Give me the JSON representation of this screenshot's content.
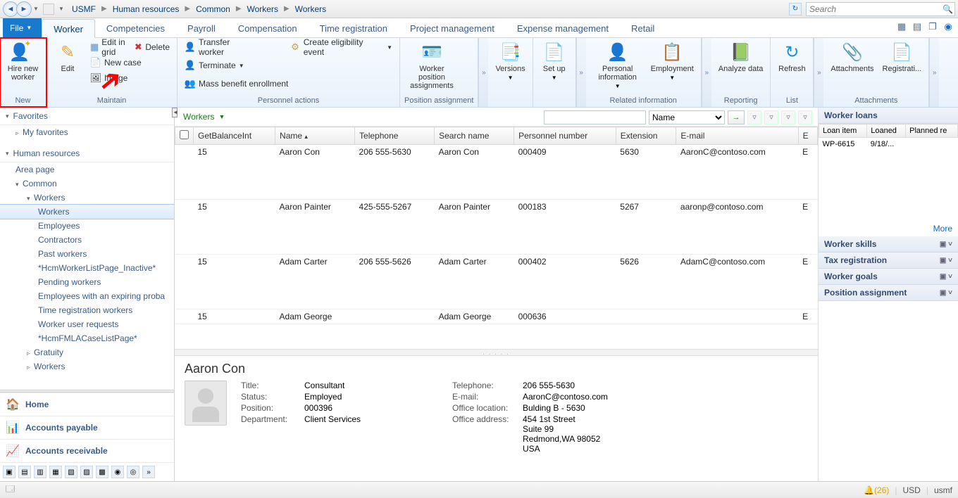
{
  "topbar": {
    "breadcrumb": [
      "USMF",
      "Human resources",
      "Common",
      "Workers",
      "Workers"
    ],
    "search_placeholder": "Search"
  },
  "ribbon": {
    "file": "File",
    "tabs": [
      "Worker",
      "Competencies",
      "Payroll",
      "Compensation",
      "Time registration",
      "Project management",
      "Expense management",
      "Retail"
    ],
    "groups": {
      "new": {
        "label": "New",
        "hire": "Hire new worker"
      },
      "maintain": {
        "label": "Maintain",
        "edit": "Edit",
        "edit_grid": "Edit in grid",
        "delete": "Delete",
        "new_case": "New case",
        "image": "Image"
      },
      "personnel": {
        "label": "Personnel actions",
        "transfer": "Transfer worker",
        "terminate": "Terminate",
        "mass": "Mass benefit enrollment",
        "eligibility": "Create eligibility event"
      },
      "position": {
        "label": "Position assignment",
        "btn": "Worker position assignments"
      },
      "versions": {
        "label": "",
        "btn": "Versions"
      },
      "setup": {
        "label": "",
        "btn": "Set up"
      },
      "related": {
        "label": "Related information",
        "personal": "Personal information",
        "employment": "Employment"
      },
      "reporting": {
        "label": "Reporting",
        "btn": "Analyze data"
      },
      "list": {
        "label": "List",
        "btn": "Refresh"
      },
      "attachments": {
        "label": "Attachments",
        "a": "Attachments",
        "b": "Registrati..."
      }
    }
  },
  "leftnav": {
    "favorites": "Favorites",
    "my_favorites": "My favorites",
    "hr": "Human resources",
    "area": "Area page",
    "common": "Common",
    "workers": "Workers",
    "items": [
      "Workers",
      "Employees",
      "Contractors",
      "Past workers",
      "*HcmWorkerListPage_Inactive*",
      "Pending workers",
      "Employees with an expiring proba",
      "Time registration workers",
      "Worker user requests",
      "*HcmFMLACaseListPage*"
    ],
    "gratuity": "Gratuity",
    "workers2": "Workers",
    "home": "Home",
    "ap": "Accounts payable",
    "ar": "Accounts receivable"
  },
  "list": {
    "title": "Workers",
    "filter_field": "Name",
    "cols": [
      "",
      "GetBalanceInt",
      "Name",
      "Telephone",
      "Search name",
      "Personnel number",
      "Extension",
      "E-mail",
      "E"
    ],
    "rows": [
      {
        "bal": "15",
        "name": "Aaron Con",
        "tel": "206 555-5630",
        "search": "Aaron Con",
        "pnum": "000409",
        "ext": "5630",
        "email": "AaronC@contoso.com",
        "e": "E"
      },
      {
        "bal": "15",
        "name": "Aaron Painter",
        "tel": "425-555-5267",
        "search": "Aaron Painter",
        "pnum": "000183",
        "ext": "5267",
        "email": "aaronp@contoso.com",
        "e": "E"
      },
      {
        "bal": "15",
        "name": "Adam Carter",
        "tel": "206 555-5626",
        "search": "Adam Carter",
        "pnum": "000402",
        "ext": "5626",
        "email": "AdamC@contoso.com",
        "e": "E"
      },
      {
        "bal": "15",
        "name": "Adam George",
        "tel": "",
        "search": "Adam George",
        "pnum": "000636",
        "ext": "",
        "email": "",
        "e": "E"
      }
    ]
  },
  "detail": {
    "name": "Aaron Con",
    "left": {
      "Title": "Consultant",
      "Status": "Employed",
      "Position": "000396",
      "Department": "Client Services"
    },
    "right": {
      "Telephone": "206 555-5630",
      "E-mail": "AaronC@contoso.com",
      "Office location": "Bulding B - 5630",
      "Office address": "454 1st Street\nSuite 99\nRedmond,WA 98052\nUSA"
    }
  },
  "rightpane": {
    "loans": {
      "hdr": "Worker loans",
      "cols": [
        "Loan item",
        "Loaned",
        "Planned re"
      ],
      "row": [
        "WP-6615",
        "9/18/...",
        ""
      ]
    },
    "more": "More",
    "sections": [
      "Worker skills",
      "Tax registration",
      "Worker goals",
      "Position assignment"
    ]
  },
  "status": {
    "bell": "(26)",
    "currency": "USD",
    "company": "usmf"
  }
}
